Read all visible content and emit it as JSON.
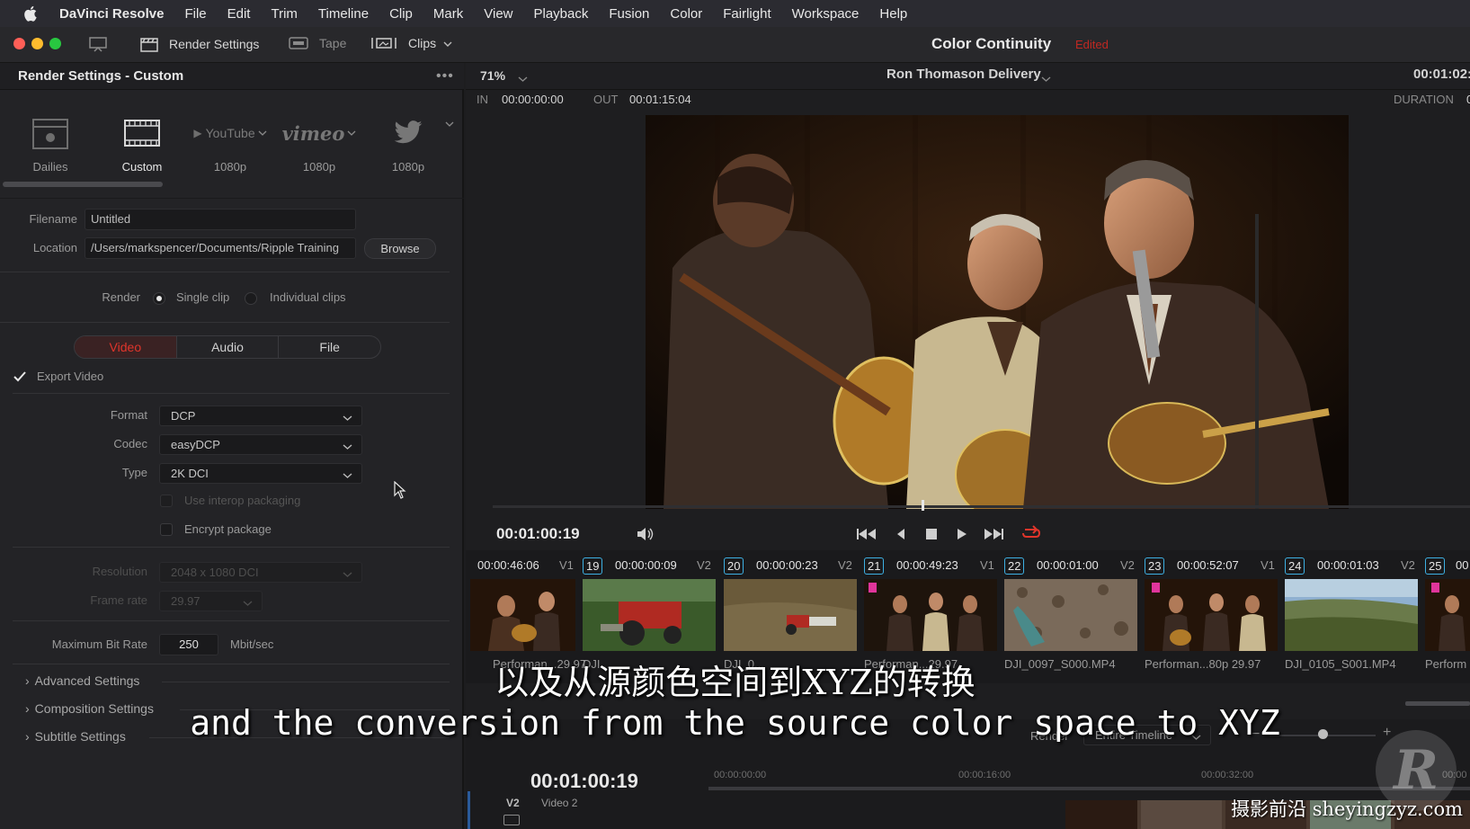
{
  "menubar": {
    "app": "DaVinci Resolve",
    "items": [
      "File",
      "Edit",
      "Trim",
      "Timeline",
      "Clip",
      "Mark",
      "View",
      "Playback",
      "Fusion",
      "Color",
      "Fairlight",
      "Workspace",
      "Help"
    ]
  },
  "toolbar": {
    "render_settings": "Render Settings",
    "tape": "Tape",
    "clips": "Clips",
    "project_title": "Color Continuity",
    "edited": "Edited"
  },
  "render_panel": {
    "title": "Render Settings - Custom",
    "presets": [
      {
        "label": "Dailies",
        "icon": "dailies-icon"
      },
      {
        "label": "Custom",
        "icon": "film-icon"
      },
      {
        "label": "1080p",
        "icon": "youtube-icon",
        "brand": "YouTube"
      },
      {
        "label": "1080p",
        "icon": "vimeo-icon",
        "brand": "vimeo"
      },
      {
        "label": "1080p",
        "icon": "twitter-icon"
      }
    ],
    "filename_label": "Filename",
    "filename_value": "Untitled",
    "location_label": "Location",
    "location_value": "/Users/markspencer/Documents/Ripple Training",
    "browse": "Browse",
    "render_label": "Render",
    "single_clip": "Single clip",
    "individual_clips": "Individual clips",
    "tabs": [
      "Video",
      "Audio",
      "File"
    ],
    "active_tab": "Video",
    "export_video": "Export Video",
    "format_label": "Format",
    "format_value": "DCP",
    "codec_label": "Codec",
    "codec_value": "easyDCP",
    "type_label": "Type",
    "type_value": "2K DCI",
    "interop": "Use interop packaging",
    "encrypt": "Encrypt package",
    "resolution_label": "Resolution",
    "resolution_value": "2048 x 1080 DCI",
    "framerate_label": "Frame rate",
    "framerate_value": "29.97",
    "bitrate_label": "Maximum Bit Rate",
    "bitrate_value": "250",
    "bitrate_unit": "Mbit/sec",
    "sections": [
      "Advanced Settings",
      "Composition Settings",
      "Subtitle Settings"
    ]
  },
  "viewer": {
    "zoom": "71%",
    "timeline_name": "Ron Thomason Delivery",
    "timecode_top": "00:01:02:",
    "in_label": "IN",
    "in_value": "00:00:00:00",
    "out_label": "OUT",
    "out_value": "00:01:15:04",
    "duration_label": "DURATION",
    "duration_value": "0",
    "playhead_tc": "00:01:00:19"
  },
  "clips": [
    {
      "num": "",
      "tc": "00:00:46:06",
      "track": "V1",
      "name": "Performan...29.97"
    },
    {
      "num": "19",
      "tc": "00:00:00:09",
      "track": "V2",
      "name": "DJI..."
    },
    {
      "num": "20",
      "tc": "00:00:00:23",
      "track": "V2",
      "name": "DJI_0..."
    },
    {
      "num": "21",
      "tc": "00:00:49:23",
      "track": "V1",
      "name": "Performan...29.97"
    },
    {
      "num": "22",
      "tc": "00:00:01:00",
      "track": "V2",
      "name": "DJI_0097_S000.MP4"
    },
    {
      "num": "23",
      "tc": "00:00:52:07",
      "track": "V1",
      "name": "Performan...80p 29.97"
    },
    {
      "num": "24",
      "tc": "00:00:01:03",
      "track": "V2",
      "name": "DJI_0105_S001.MP4"
    },
    {
      "num": "25",
      "tc": "00",
      "track": "",
      "name": "Perform"
    }
  ],
  "timeline": {
    "render_label": "Render",
    "render_value": "Entire Timeline",
    "tc": "00:01:00:19",
    "ruler": [
      "00:00:00:00",
      "00:00:16:00",
      "00:00:32:00",
      "00:00"
    ],
    "track": "V2",
    "track_name": "Video 2"
  },
  "subtitles": {
    "zh": "以及从源颜色空间到XYZ的转换",
    "en": "and the conversion from the source color space to XYZ"
  },
  "watermark": "摄影前沿 sheyingzyz.com",
  "colors": {
    "accent_red": "#e0352b",
    "clip_blue": "#3db0e3",
    "flag_pink": "#e0359b"
  }
}
